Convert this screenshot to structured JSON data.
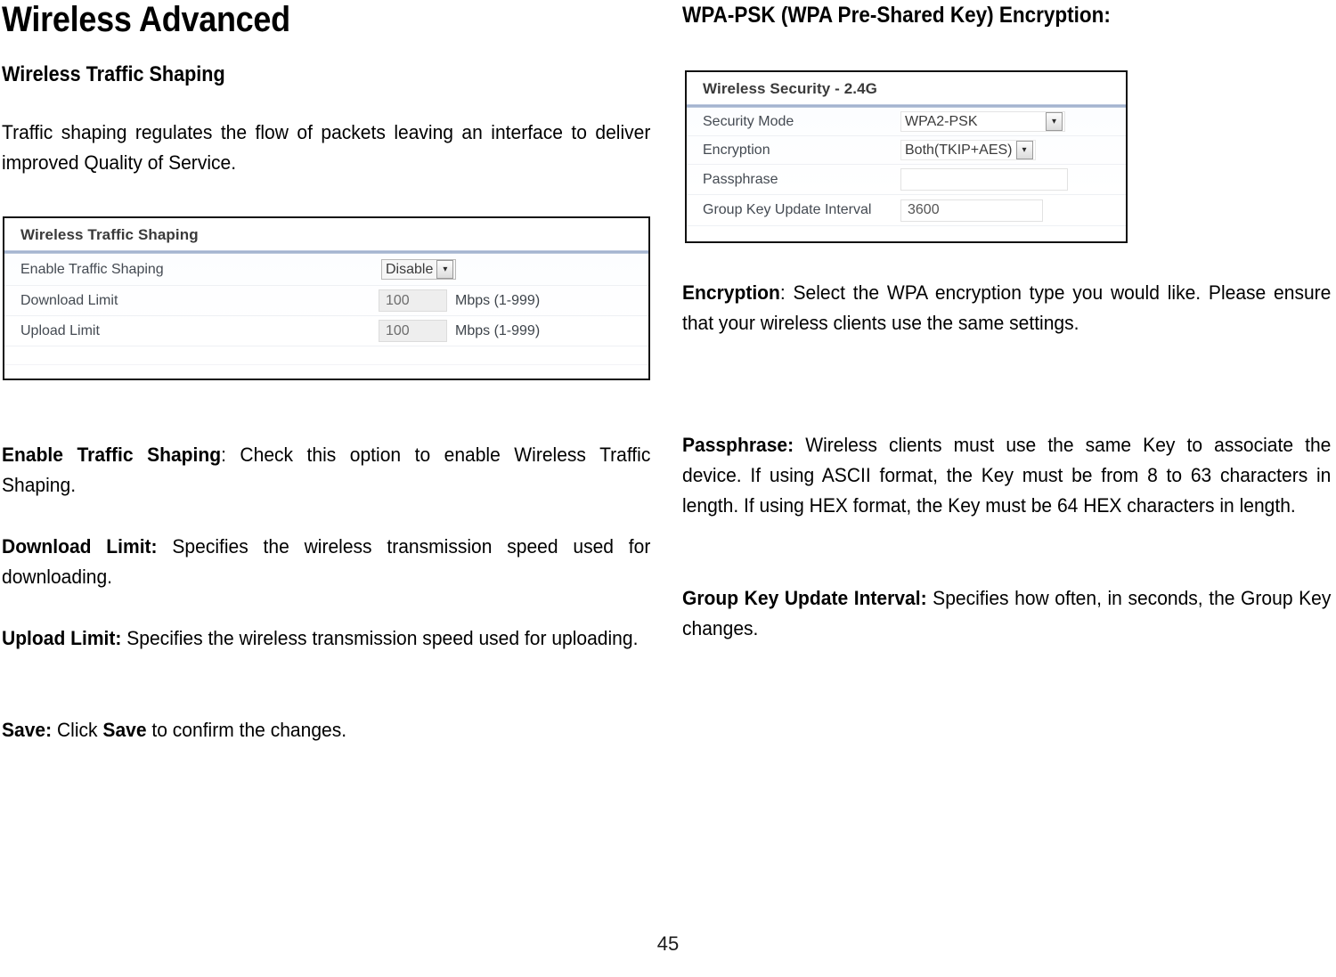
{
  "page": {
    "number": "45"
  },
  "left_column": {
    "doc_title": "Wireless Advanced",
    "section_title": "Wireless Traffic Shaping",
    "intro_paragraph": "Traffic shaping regulates the flow of packets leaving an interface to deliver improved Quality of Service.",
    "figure": {
      "title": "Wireless Traffic Shaping",
      "rows": [
        {
          "label": "Enable Traffic Shaping",
          "control": "select",
          "value": "Disable",
          "arrow_icon": "chevron-down-icon",
          "unit": ""
        },
        {
          "label": "Download Limit",
          "control": "text",
          "value": "100",
          "unit": "Mbps (1-999)"
        },
        {
          "label": "Upload Limit",
          "control": "text",
          "value": "100",
          "unit": "Mbps (1-999)"
        }
      ]
    },
    "descriptions": [
      {
        "term": "Enable Traffic Shaping",
        "separator": ": ",
        "text": "Check this option to enable Wireless Traffic Shaping."
      },
      {
        "term": "Download Limit:",
        "separator": " ",
        "text": "Specifies the wireless transmission speed used for downloading."
      },
      {
        "term": "Upload Limit:",
        "separator": " ",
        "text": "Specifies the wireless transmission speed used for uploading."
      }
    ],
    "save_note": {
      "term": "Save:",
      "text_before": " Click ",
      "bold_word": "Save",
      "text_after": " to confirm the changes."
    }
  },
  "right_column": {
    "heading": "WPA-PSK (WPA Pre-Shared Key) Encryption:",
    "figure": {
      "title": "Wireless Security - 2.4G",
      "rows": [
        {
          "label": "Security Mode",
          "control": "select",
          "value": "WPA2-PSK",
          "arrow_icon": "chevron-down-icon"
        },
        {
          "label": "Encryption",
          "control": "select",
          "value": "Both(TKIP+AES)",
          "arrow_icon": "chevron-down-icon"
        },
        {
          "label": "Passphrase",
          "control": "text",
          "value": ""
        },
        {
          "label": "Group Key Update Interval",
          "control": "text",
          "value": "3600"
        }
      ]
    },
    "descriptions": [
      {
        "term": "Encryption",
        "separator": ": ",
        "text": "Select the WPA encryption type you would like. Please ensure that your wireless clients use the same settings."
      },
      {
        "term": "Passphrase:",
        "separator": " ",
        "text": "Wireless clients must use the same Key to associate the device. If using ASCII format, the Key must be from 8 to 63 characters in length. If using HEX format, the Key must be 64 HEX characters in length."
      },
      {
        "term": "Group Key Update Interval:",
        "separator": " ",
        "text": "Specifies how often, in seconds, the Group Key changes."
      }
    ]
  },
  "colors": {
    "panel_rule": "#9aabc9",
    "panel_border": "#111111",
    "label_text": "#444a52",
    "field_value": "#6d6d6d"
  }
}
